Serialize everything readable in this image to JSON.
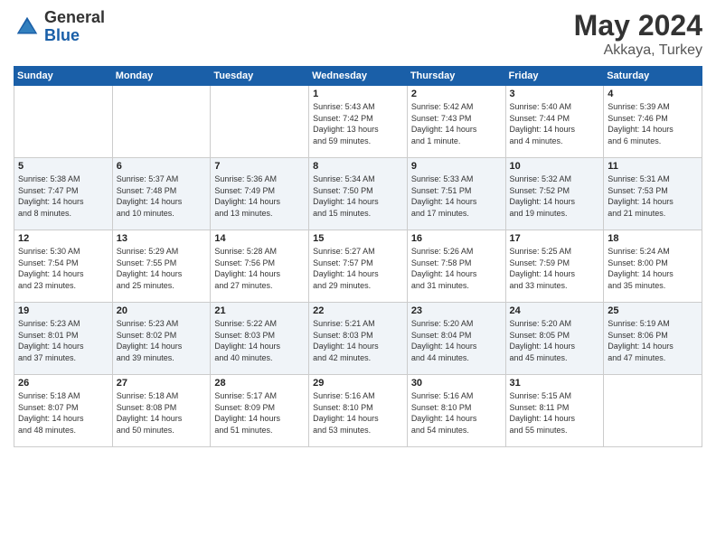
{
  "logo": {
    "general": "General",
    "blue": "Blue"
  },
  "title": {
    "month": "May 2024",
    "location": "Akkaya, Turkey"
  },
  "days_of_week": [
    "Sunday",
    "Monday",
    "Tuesday",
    "Wednesday",
    "Thursday",
    "Friday",
    "Saturday"
  ],
  "weeks": [
    [
      {
        "day": "",
        "info": ""
      },
      {
        "day": "",
        "info": ""
      },
      {
        "day": "",
        "info": ""
      },
      {
        "day": "1",
        "info": "Sunrise: 5:43 AM\nSunset: 7:42 PM\nDaylight: 13 hours\nand 59 minutes."
      },
      {
        "day": "2",
        "info": "Sunrise: 5:42 AM\nSunset: 7:43 PM\nDaylight: 14 hours\nand 1 minute."
      },
      {
        "day": "3",
        "info": "Sunrise: 5:40 AM\nSunset: 7:44 PM\nDaylight: 14 hours\nand 4 minutes."
      },
      {
        "day": "4",
        "info": "Sunrise: 5:39 AM\nSunset: 7:46 PM\nDaylight: 14 hours\nand 6 minutes."
      }
    ],
    [
      {
        "day": "5",
        "info": "Sunrise: 5:38 AM\nSunset: 7:47 PM\nDaylight: 14 hours\nand 8 minutes."
      },
      {
        "day": "6",
        "info": "Sunrise: 5:37 AM\nSunset: 7:48 PM\nDaylight: 14 hours\nand 10 minutes."
      },
      {
        "day": "7",
        "info": "Sunrise: 5:36 AM\nSunset: 7:49 PM\nDaylight: 14 hours\nand 13 minutes."
      },
      {
        "day": "8",
        "info": "Sunrise: 5:34 AM\nSunset: 7:50 PM\nDaylight: 14 hours\nand 15 minutes."
      },
      {
        "day": "9",
        "info": "Sunrise: 5:33 AM\nSunset: 7:51 PM\nDaylight: 14 hours\nand 17 minutes."
      },
      {
        "day": "10",
        "info": "Sunrise: 5:32 AM\nSunset: 7:52 PM\nDaylight: 14 hours\nand 19 minutes."
      },
      {
        "day": "11",
        "info": "Sunrise: 5:31 AM\nSunset: 7:53 PM\nDaylight: 14 hours\nand 21 minutes."
      }
    ],
    [
      {
        "day": "12",
        "info": "Sunrise: 5:30 AM\nSunset: 7:54 PM\nDaylight: 14 hours\nand 23 minutes."
      },
      {
        "day": "13",
        "info": "Sunrise: 5:29 AM\nSunset: 7:55 PM\nDaylight: 14 hours\nand 25 minutes."
      },
      {
        "day": "14",
        "info": "Sunrise: 5:28 AM\nSunset: 7:56 PM\nDaylight: 14 hours\nand 27 minutes."
      },
      {
        "day": "15",
        "info": "Sunrise: 5:27 AM\nSunset: 7:57 PM\nDaylight: 14 hours\nand 29 minutes."
      },
      {
        "day": "16",
        "info": "Sunrise: 5:26 AM\nSunset: 7:58 PM\nDaylight: 14 hours\nand 31 minutes."
      },
      {
        "day": "17",
        "info": "Sunrise: 5:25 AM\nSunset: 7:59 PM\nDaylight: 14 hours\nand 33 minutes."
      },
      {
        "day": "18",
        "info": "Sunrise: 5:24 AM\nSunset: 8:00 PM\nDaylight: 14 hours\nand 35 minutes."
      }
    ],
    [
      {
        "day": "19",
        "info": "Sunrise: 5:23 AM\nSunset: 8:01 PM\nDaylight: 14 hours\nand 37 minutes."
      },
      {
        "day": "20",
        "info": "Sunrise: 5:23 AM\nSunset: 8:02 PM\nDaylight: 14 hours\nand 39 minutes."
      },
      {
        "day": "21",
        "info": "Sunrise: 5:22 AM\nSunset: 8:03 PM\nDaylight: 14 hours\nand 40 minutes."
      },
      {
        "day": "22",
        "info": "Sunrise: 5:21 AM\nSunset: 8:03 PM\nDaylight: 14 hours\nand 42 minutes."
      },
      {
        "day": "23",
        "info": "Sunrise: 5:20 AM\nSunset: 8:04 PM\nDaylight: 14 hours\nand 44 minutes."
      },
      {
        "day": "24",
        "info": "Sunrise: 5:20 AM\nSunset: 8:05 PM\nDaylight: 14 hours\nand 45 minutes."
      },
      {
        "day": "25",
        "info": "Sunrise: 5:19 AM\nSunset: 8:06 PM\nDaylight: 14 hours\nand 47 minutes."
      }
    ],
    [
      {
        "day": "26",
        "info": "Sunrise: 5:18 AM\nSunset: 8:07 PM\nDaylight: 14 hours\nand 48 minutes."
      },
      {
        "day": "27",
        "info": "Sunrise: 5:18 AM\nSunset: 8:08 PM\nDaylight: 14 hours\nand 50 minutes."
      },
      {
        "day": "28",
        "info": "Sunrise: 5:17 AM\nSunset: 8:09 PM\nDaylight: 14 hours\nand 51 minutes."
      },
      {
        "day": "29",
        "info": "Sunrise: 5:16 AM\nSunset: 8:10 PM\nDaylight: 14 hours\nand 53 minutes."
      },
      {
        "day": "30",
        "info": "Sunrise: 5:16 AM\nSunset: 8:10 PM\nDaylight: 14 hours\nand 54 minutes."
      },
      {
        "day": "31",
        "info": "Sunrise: 5:15 AM\nSunset: 8:11 PM\nDaylight: 14 hours\nand 55 minutes."
      },
      {
        "day": "",
        "info": ""
      }
    ]
  ]
}
